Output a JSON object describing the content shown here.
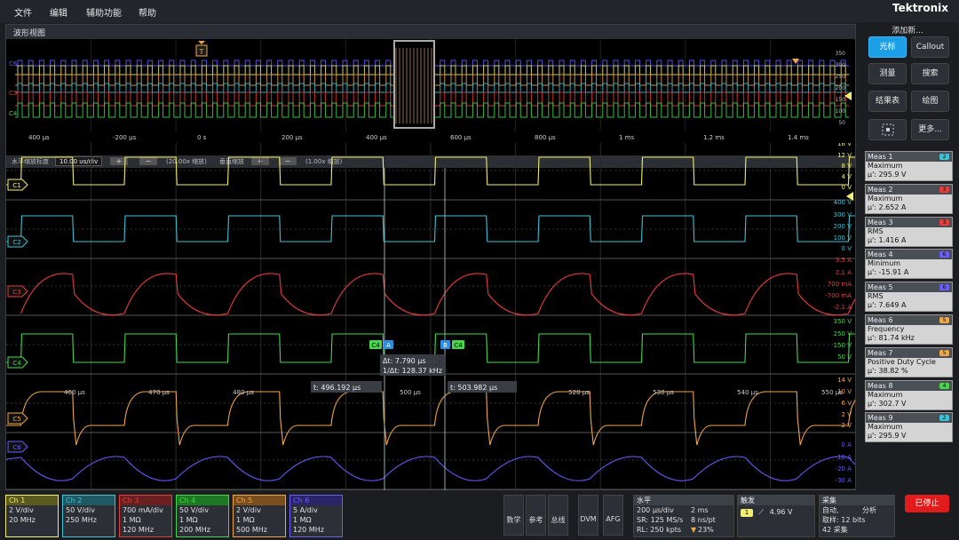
{
  "menu": {
    "file": "文件",
    "edit": "编辑",
    "utility": "辅助功能",
    "help": "帮助",
    "logo": "Tektronix"
  },
  "window": {
    "title": "波形视图"
  },
  "overview": {
    "time_labels": [
      "400 μs",
      "-200 μs",
      "0 s",
      "200 μs",
      "400 μs",
      "600 μs",
      "800 μs",
      "1 ms",
      "1.2 ms",
      "1.4 ms"
    ],
    "trigger_marker": "T",
    "right_labels": [
      "350",
      "300",
      "250",
      "200",
      "150",
      "100",
      "50"
    ],
    "channel_markers": [
      "C6",
      "C3",
      "C4"
    ]
  },
  "zoombar": {
    "h_zoom_label": "水平缩放标度",
    "h_zoom_value": "10.00 us/div",
    "h_factor": "(20.00x 缩放)",
    "v_zoom_label": "垂直缩放",
    "v_factor": "(1.00x 缩放)"
  },
  "channels": {
    "c1": {
      "marker": "C1",
      "color": "#f2ed74",
      "scale": [
        "16 V",
        "12 V",
        "8 V",
        "4 V",
        "0 V"
      ]
    },
    "c2": {
      "marker": "C2",
      "color": "#3ec3d6",
      "scale": [
        "400 V",
        "300 V",
        "200 V",
        "100 V",
        "0 V"
      ]
    },
    "c3": {
      "marker": "C3",
      "color": "#e63c3c",
      "scale": [
        "3.5 A",
        "2.1 A",
        "700 mA",
        "-700 mA",
        "-2.1 A"
      ]
    },
    "c4": {
      "marker": "C4",
      "color": "#44d84a",
      "scale": [
        "350 V",
        "250 V",
        "150 V",
        "50 V"
      ]
    },
    "c5": {
      "marker": "C5",
      "color": "#f0a64b",
      "scale": [
        "14 V",
        "10 V",
        "6 V",
        "2 V",
        "-2 V"
      ]
    },
    "c6": {
      "marker": "C6",
      "color": "#6a5dff",
      "scale": [
        "0 A",
        "-10 A",
        "-20 A",
        "-30 A"
      ]
    }
  },
  "c4_time_axis": [
    "460 μs",
    "470 μs",
    "480 μs",
    "500 μs",
    "520 μs",
    "530 μs",
    "540 μs",
    "550 μs"
  ],
  "cursors": {
    "a_label": "A",
    "b_label": "B",
    "a_chan": "C4",
    "b_chan": "C4",
    "delta_t": "Δt: 7.790 μs",
    "inv_delta_t": "1/Δt: 128.37 kHz",
    "t_a": "t: 496.192 μs",
    "t_b": "t: 503.982 μs"
  },
  "right_panel": {
    "add_new": "添加新...",
    "buttons": {
      "cursor": "光标",
      "callout": "Callout",
      "measure": "测量",
      "search": "搜索",
      "results": "结果表",
      "plot": "绘图",
      "more": "更多..."
    }
  },
  "measurements": [
    {
      "name": "Meas 1",
      "type": "Maximum",
      "value": "μ': 295.9 V",
      "ch": "2",
      "color": "#3ec3d6"
    },
    {
      "name": "Meas 2",
      "type": "Maximum",
      "value": "μ': 2.652 A",
      "ch": "3",
      "color": "#e63c3c"
    },
    {
      "name": "Meas 3",
      "type": "RMS",
      "value": "μ': 1.416 A",
      "ch": "3",
      "color": "#e63c3c"
    },
    {
      "name": "Meas 4",
      "type": "Minimum",
      "value": "μ': -15.91 A",
      "ch": "6",
      "color": "#6a5dff"
    },
    {
      "name": "Meas 5",
      "type": "RMS",
      "value": "μ': 7.649 A",
      "ch": "6",
      "color": "#6a5dff"
    },
    {
      "name": "Meas 6",
      "type": "Frequency",
      "value": "μ': 81.74 kHz",
      "ch": "5",
      "color": "#f0a64b"
    },
    {
      "name": "Meas 7",
      "type": "Positive Duty Cycle",
      "value": "μ': 38.82 %",
      "ch": "5",
      "color": "#f0a64b"
    },
    {
      "name": "Meas 8",
      "type": "Maximum",
      "value": "μ': 302.7 V",
      "ch": "4",
      "color": "#44d84a"
    },
    {
      "name": "Meas 9",
      "type": "Maximum",
      "value": "μ': 295.9 V",
      "ch": "2",
      "color": "#3ec3d6"
    }
  ],
  "bottom": {
    "ch": [
      {
        "name": "Ch 1",
        "l1": "2 V/div",
        "l2": "",
        "l3": "20 MHz",
        "color": "#f2ed74",
        "hc": "#5a5a1e"
      },
      {
        "name": "Ch 2",
        "l1": "50 V/div",
        "l2": "",
        "l3": "250 MHz",
        "color": "#3ec3d6",
        "hc": "#1f5a64"
      },
      {
        "name": "Ch 3",
        "l1": "700 mA/div",
        "l2": "1 MΩ",
        "l3": "120 MHz",
        "color": "#e63c3c",
        "hc": "#6a2020"
      },
      {
        "name": "Ch 4",
        "l1": "50 V/div",
        "l2": "1 MΩ",
        "l3": "200 MHz",
        "color": "#44d84a",
        "hc": "#1d7a22"
      },
      {
        "name": "Ch 5",
        "l1": "2 V/div",
        "l2": "1 MΩ",
        "l3": "500 MHz",
        "color": "#f0a64b",
        "hc": "#7a4f1d"
      },
      {
        "name": "Ch 6",
        "l1": "5 A/div",
        "l2": "1 MΩ",
        "l3": "120 MHz",
        "color": "#6a5dff",
        "hc": "#2a2468"
      }
    ],
    "digital": "数学",
    "ref": "参考",
    "bus": "总线",
    "dvm": "DVM",
    "afg": "AFG",
    "horizontal": {
      "title": "水平",
      "l1a": "200 μs/div",
      "l1b": "2 ms",
      "l2a": "SR: 125 MS/s",
      "l2b": "8 ns/pt",
      "l3a": "RL: 250 kpts",
      "l3b": "23%"
    },
    "trigger": {
      "title": "触发",
      "chan": "1",
      "level": "4.96 V"
    },
    "acquire": {
      "title": "采集",
      "l1a": "自动,",
      "l1b": "分析",
      "l2": "取样: 12 bits",
      "l3": "42 采集"
    },
    "stop": "已停止"
  }
}
